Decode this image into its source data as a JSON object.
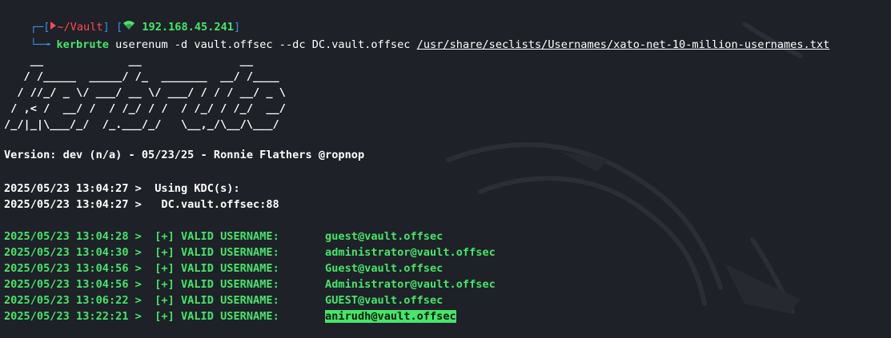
{
  "prompt": {
    "corner_top": "┌─[",
    "skull_icon": "skull-icon",
    "cwd": "~/Vault",
    "bracket_mid": "] [",
    "wifi_icon": "wifi-icon",
    "ip": "192.168.45.241",
    "bracket_end": "]",
    "corner_bottom": "└─╼",
    "command": "kerbrute",
    "args": "userenum -d vault.offsec --dc DC.vault.offsec",
    "wordlist": "/usr/share/seclists/Usernames/xato-net-10-million-usernames.txt"
  },
  "banner": {
    "ascii_lines": [
      "    __             __               __     ",
      "   / /_____  _____/ /_  _______  __/ /____ ",
      "  / //_/ _ \\/ ___/ __ \\/ ___/ / / / __/ _ \\",
      " / ,< /  __/ /  / /_/ / /  / /_/ / /_/  __/",
      "/_/|_|\\___/_/  /_.___/_/   \\__,_/\\__/\\___/ "
    ],
    "version": "Version: dev (n/a) - 05/23/25 - Ronnie Flathers @ropnop"
  },
  "log": {
    "kdc_lines": [
      {
        "timestamp": "2025/05/23 13:04:27 >",
        "message": "  Using KDC(s):"
      },
      {
        "timestamp": "2025/05/23 13:04:27 >",
        "message": "   DC.vault.offsec:88"
      }
    ],
    "valid_entries": [
      {
        "timestamp": "2025/05/23 13:04:28 >",
        "tag": "[+] VALID USERNAME:",
        "user": "guest@vault.offsec"
      },
      {
        "timestamp": "2025/05/23 13:04:30 >",
        "tag": "[+] VALID USERNAME:",
        "user": "administrator@vault.offsec"
      },
      {
        "timestamp": "2025/05/23 13:04:56 >",
        "tag": "[+] VALID USERNAME:",
        "user": "Guest@vault.offsec"
      },
      {
        "timestamp": "2025/05/23 13:04:56 >",
        "tag": "[+] VALID USERNAME:",
        "user": "Administrator@vault.offsec"
      },
      {
        "timestamp": "2025/05/23 13:06:22 >",
        "tag": "[+] VALID USERNAME:",
        "user": "GUEST@vault.offsec"
      },
      {
        "timestamp": "2025/05/23 13:22:21 >",
        "tag": "[+] VALID USERNAME:",
        "user": "anirudh@vault.offsec"
      }
    ]
  },
  "colors": {
    "background": "#1e2127",
    "prompt_blue": "#3b8ee8",
    "prompt_red": "#ff4a56",
    "success_green": "#45e66a",
    "text": "#ffffff"
  }
}
